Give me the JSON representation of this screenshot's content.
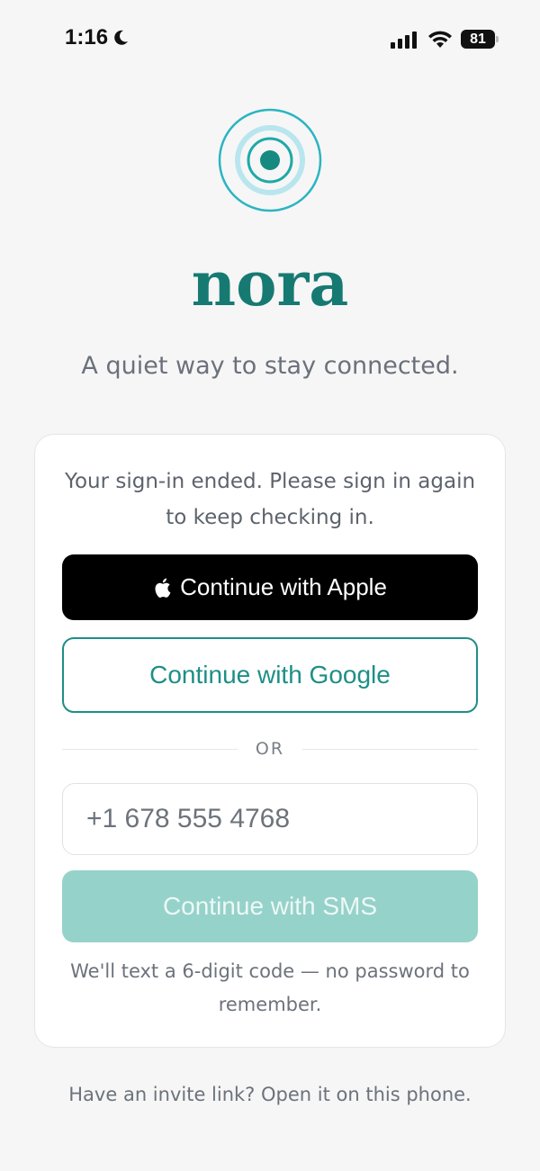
{
  "status_bar": {
    "time": "1:16",
    "battery_level": "81",
    "icons": [
      "moon-icon",
      "cellular-signal-icon",
      "wifi-icon",
      "battery-icon"
    ]
  },
  "brand": {
    "logo_icon": "concentric-rings-logo",
    "name": "nora",
    "tagline": "A quiet way to stay connected."
  },
  "card": {
    "message": "Your sign-in ended. Please sign in again to keep checking in.",
    "apple_button_label": "Continue with Apple",
    "google_button_label": "Continue with Google",
    "divider_text": "OR",
    "phone_value": "+1 678 555 4768",
    "sms_button_label": "Continue with SMS",
    "sms_note": "We'll text a 6-digit code — no password to remember."
  },
  "footer": {
    "invite_note": "Have an invite link? Open it on this phone."
  },
  "colors": {
    "brand": "#177a72",
    "accent": "#1e8f86",
    "sms_button_disabled": "#95d2ca",
    "logo_ring": "#2bb5c0",
    "logo_ring_light": "#b9e6ee"
  }
}
